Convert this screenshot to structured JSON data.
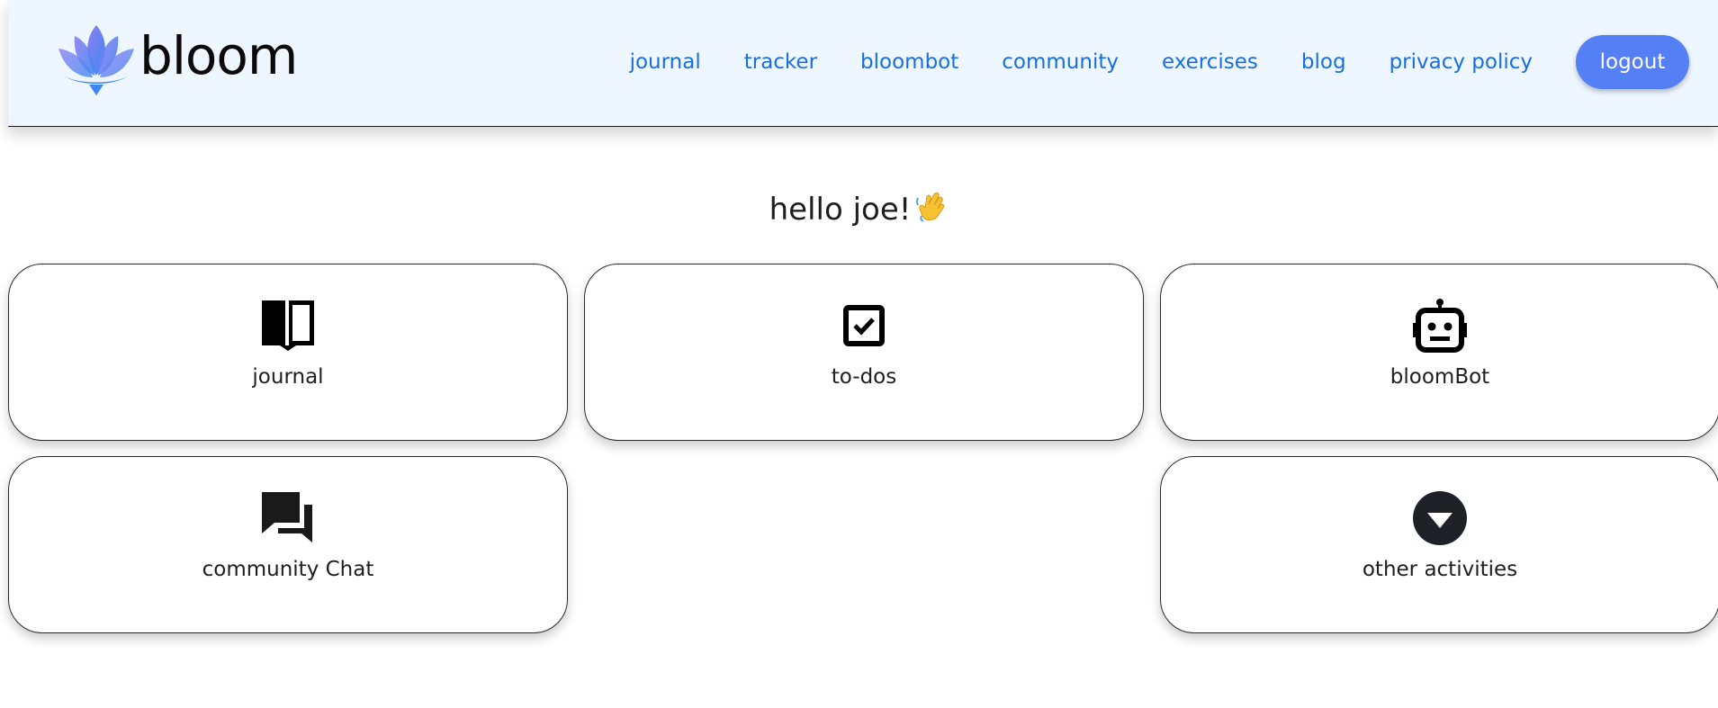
{
  "brand": {
    "name": "bloom",
    "logo_icon": "lotus-logo"
  },
  "nav": {
    "links": [
      "journal",
      "tracker",
      "bloombot",
      "community",
      "exercises",
      "blog",
      "privacy policy"
    ],
    "logout_label": "logout"
  },
  "greeting": {
    "text": "hello joe!",
    "emoji": "waving-hand-icon"
  },
  "cards": [
    {
      "label": "journal",
      "icon": "book-icon"
    },
    {
      "label": "to-dos",
      "icon": "checkbox-icon"
    },
    {
      "label": "bloomBot",
      "icon": "robot-icon"
    },
    {
      "label": "community Chat",
      "icon": "chat-bubbles-icon"
    },
    {
      "label": "other activities",
      "icon": "caret-down-circle-icon"
    }
  ],
  "colors": {
    "nav_background": "#eef6ff",
    "nav_link": "#1a6fe0",
    "logout_button": "#5580f5",
    "logo_gradient_start": "#4d8df5",
    "logo_gradient_end": "#8f7ff0"
  }
}
